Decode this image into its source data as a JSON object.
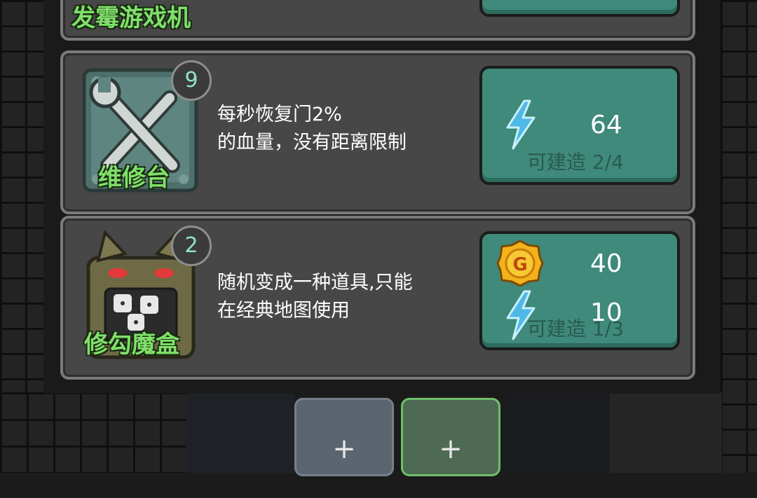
{
  "top_card": {
    "name": "发霉游戏机"
  },
  "items": [
    {
      "name": "维修台",
      "level": "9",
      "description_lines": [
        "每秒恢复门2%",
        "的血量，没有距离限制"
      ],
      "costs": [
        {
          "icon": "lightning-icon",
          "amount": "64"
        }
      ],
      "build_status": "可建造 2/4"
    },
    {
      "name": "修勾魔盒",
      "level": "2",
      "description_lines": [
        "随机变成一种道具,只能",
        "在经典地图使用"
      ],
      "costs": [
        {
          "icon": "gold-coin-icon",
          "amount": "40",
          "symbol": "G"
        },
        {
          "icon": "lightning-icon",
          "amount": "10"
        }
      ],
      "build_status": "可建造 1/3"
    }
  ],
  "slots": [
    {
      "label": "+"
    },
    {
      "label": "+"
    }
  ],
  "colors": {
    "card_bg": "#474747",
    "button_bg": "#3f8a7a",
    "name_green": "#7fe06a",
    "badge_text": "#8fe3c6"
  }
}
